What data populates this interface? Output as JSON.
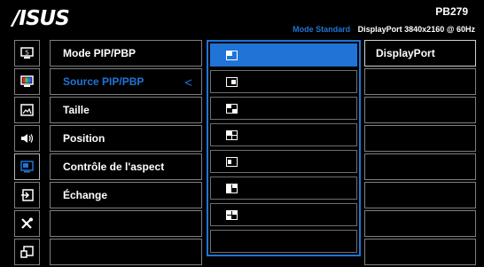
{
  "header": {
    "brand": "/ISUS",
    "model": "PB279",
    "mode": "Mode Standard",
    "signal": "DisplayPort  3840x2160 @ 60Hz"
  },
  "sidebar": {
    "items": [
      {
        "icon": "splendid-icon"
      },
      {
        "icon": "color-icon"
      },
      {
        "icon": "image-icon"
      },
      {
        "icon": "sound-icon"
      },
      {
        "icon": "pip-pbp-icon",
        "selected": true
      },
      {
        "icon": "input-select-icon"
      },
      {
        "icon": "system-setup-icon"
      },
      {
        "icon": "shortcut-icon"
      }
    ]
  },
  "menu": {
    "items": [
      {
        "label": "Mode PIP/PBP"
      },
      {
        "label": "Source PIP/PBP",
        "active": true,
        "chevron": "<"
      },
      {
        "label": "Taille"
      },
      {
        "label": "Position"
      },
      {
        "label": "Contrôle de l'aspect"
      },
      {
        "label": "Échange"
      },
      {
        "label": ""
      },
      {
        "label": ""
      }
    ]
  },
  "options": {
    "items": [
      {
        "icon": "layout-top-left-icon",
        "selected": true
      },
      {
        "icon": "layout-right-inset-icon"
      },
      {
        "icon": "layout-quad-icon"
      },
      {
        "icon": "layout-quad-grid-icon"
      },
      {
        "icon": "layout-left-small-icon"
      },
      {
        "icon": "layout-split-icon"
      },
      {
        "icon": "layout-quad-alt-icon"
      },
      {
        "icon": ""
      }
    ]
  },
  "values": {
    "items": [
      {
        "label": "DisplayPort"
      },
      {
        "label": ""
      },
      {
        "label": ""
      },
      {
        "label": ""
      },
      {
        "label": ""
      },
      {
        "label": ""
      },
      {
        "label": ""
      },
      {
        "label": ""
      }
    ]
  },
  "colors": {
    "accent": "#1f74d6",
    "border": "#7f7f7f",
    "background": "#000000"
  }
}
